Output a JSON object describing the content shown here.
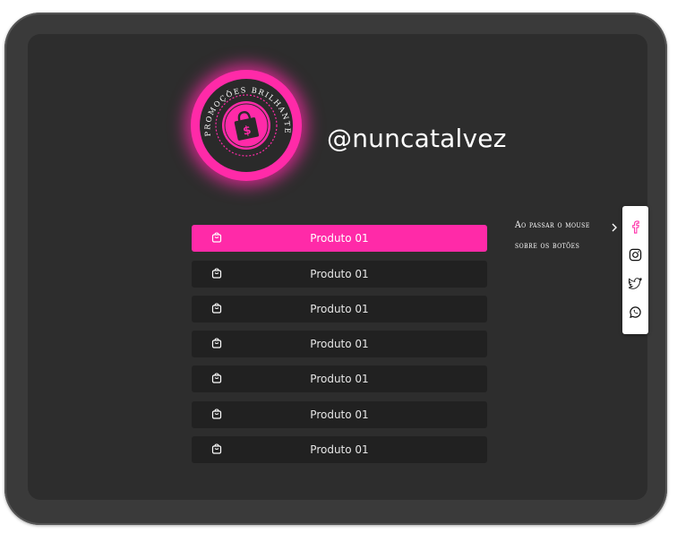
{
  "profile": {
    "handle": "@nuncatalvez",
    "logo_text": "PROMOÇÕES BRILHANTE",
    "logo_symbol": "$"
  },
  "buttons": [
    {
      "label": "Produto 01",
      "active": true
    },
    {
      "label": "Produto 01",
      "active": false
    },
    {
      "label": "Produto 01",
      "active": false
    },
    {
      "label": "Produto 01",
      "active": false
    },
    {
      "label": "Produto 01",
      "active": false
    },
    {
      "label": "Produto 01",
      "active": false
    },
    {
      "label": "Produto 01",
      "active": false
    }
  ],
  "hint": {
    "line1": "Ao passar o mouse",
    "line2": "sobre os botões"
  },
  "social": [
    "facebook-icon",
    "instagram-icon",
    "twitter-icon",
    "whatsapp-icon"
  ],
  "colors": {
    "accent": "#ff2aa8",
    "background": "#2d2d2d",
    "button": "#212121"
  }
}
